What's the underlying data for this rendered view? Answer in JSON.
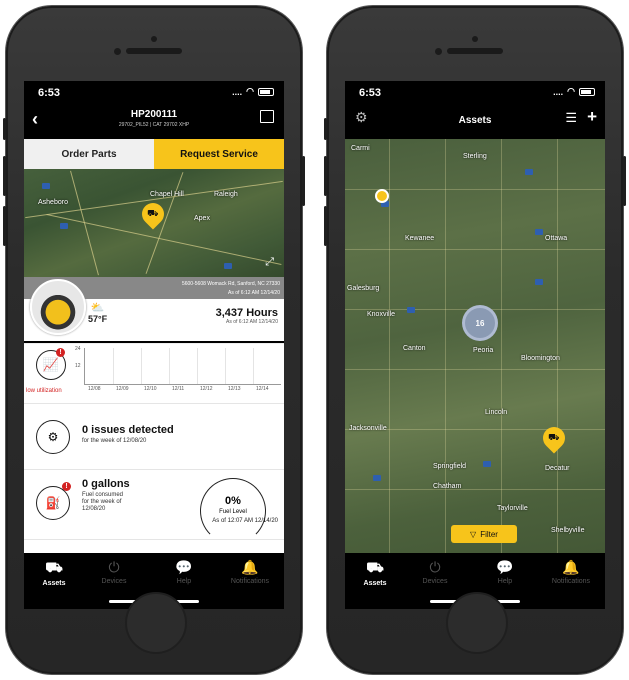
{
  "left_phone": {
    "status": {
      "time": "6:53",
      "signal": "....",
      "wifi": "wifi-icon",
      "battery": "battery-icon"
    },
    "header": {
      "title": "HP200111",
      "subtitle": "29702_PIL52 | CAT 29702 XHP"
    },
    "tabs": [
      {
        "label": "Order Parts"
      },
      {
        "label": "Request Service"
      }
    ],
    "map": {
      "labels": [
        "Chapel Hill",
        "Raleigh",
        "Asheboro",
        "Apex"
      ]
    },
    "address": {
      "line1": "5600-5608 Womack Rd, Sanford, NC 27330",
      "line2": "As of 6:12 AM 12/14/20"
    },
    "weather": {
      "temp": "57°F",
      "icon": "partly-cloudy-icon"
    },
    "hours": {
      "value": "3,437 Hours",
      "asof": "As of 6:12 AM 12/14/20"
    },
    "utilization": {
      "label": "low utilization",
      "yticks": [
        "24",
        "12"
      ],
      "xticks": [
        "12/08",
        "12/09",
        "12/10",
        "12/11",
        "12/12",
        "12/13",
        "12/14"
      ],
      "badge": "!"
    },
    "issues": {
      "title": "0 issues detected",
      "subtitle": "for the week of 12/08/20"
    },
    "fuel": {
      "title": "0 gallons",
      "line1": "Fuel consumed",
      "line2": "for the week of",
      "line3": "12/08/20",
      "gauge_pct": "0%",
      "gauge_label": "Fuel Level",
      "asof": "As of 12:07 AM 12/14/20",
      "badge": "!"
    },
    "tabbar": [
      {
        "label": "Assets",
        "icon": "excavator-icon"
      },
      {
        "label": "Devices",
        "icon": "power-icon"
      },
      {
        "label": "Help",
        "icon": "chat-icon"
      },
      {
        "label": "Notifications",
        "icon": "bell-icon"
      }
    ]
  },
  "right_phone": {
    "status": {
      "time": "6:53",
      "signal": "....",
      "wifi": "wifi-icon",
      "battery": "battery-icon"
    },
    "header": {
      "title": "Assets"
    },
    "map": {
      "labels": [
        "Sterling",
        "Kewanee",
        "Ottawa",
        "Galesburg",
        "Knoxville",
        "Canton",
        "Peoria",
        "Bloomington",
        "Lincoln",
        "Springfield",
        "Chatham",
        "Taylorville",
        "Decatur",
        "Shelbyville",
        "Jacksonville",
        "Carmi"
      ],
      "cluster_count": "16"
    },
    "filter": {
      "label": "Filter"
    },
    "tabbar": [
      {
        "label": "Assets",
        "icon": "excavator-icon"
      },
      {
        "label": "Devices",
        "icon": "power-icon"
      },
      {
        "label": "Help",
        "icon": "chat-icon"
      },
      {
        "label": "Notifications",
        "icon": "bell-icon"
      }
    ]
  },
  "colors": {
    "accent": "#f7c41b",
    "alert": "#d32222",
    "tabbar": "#000000"
  }
}
